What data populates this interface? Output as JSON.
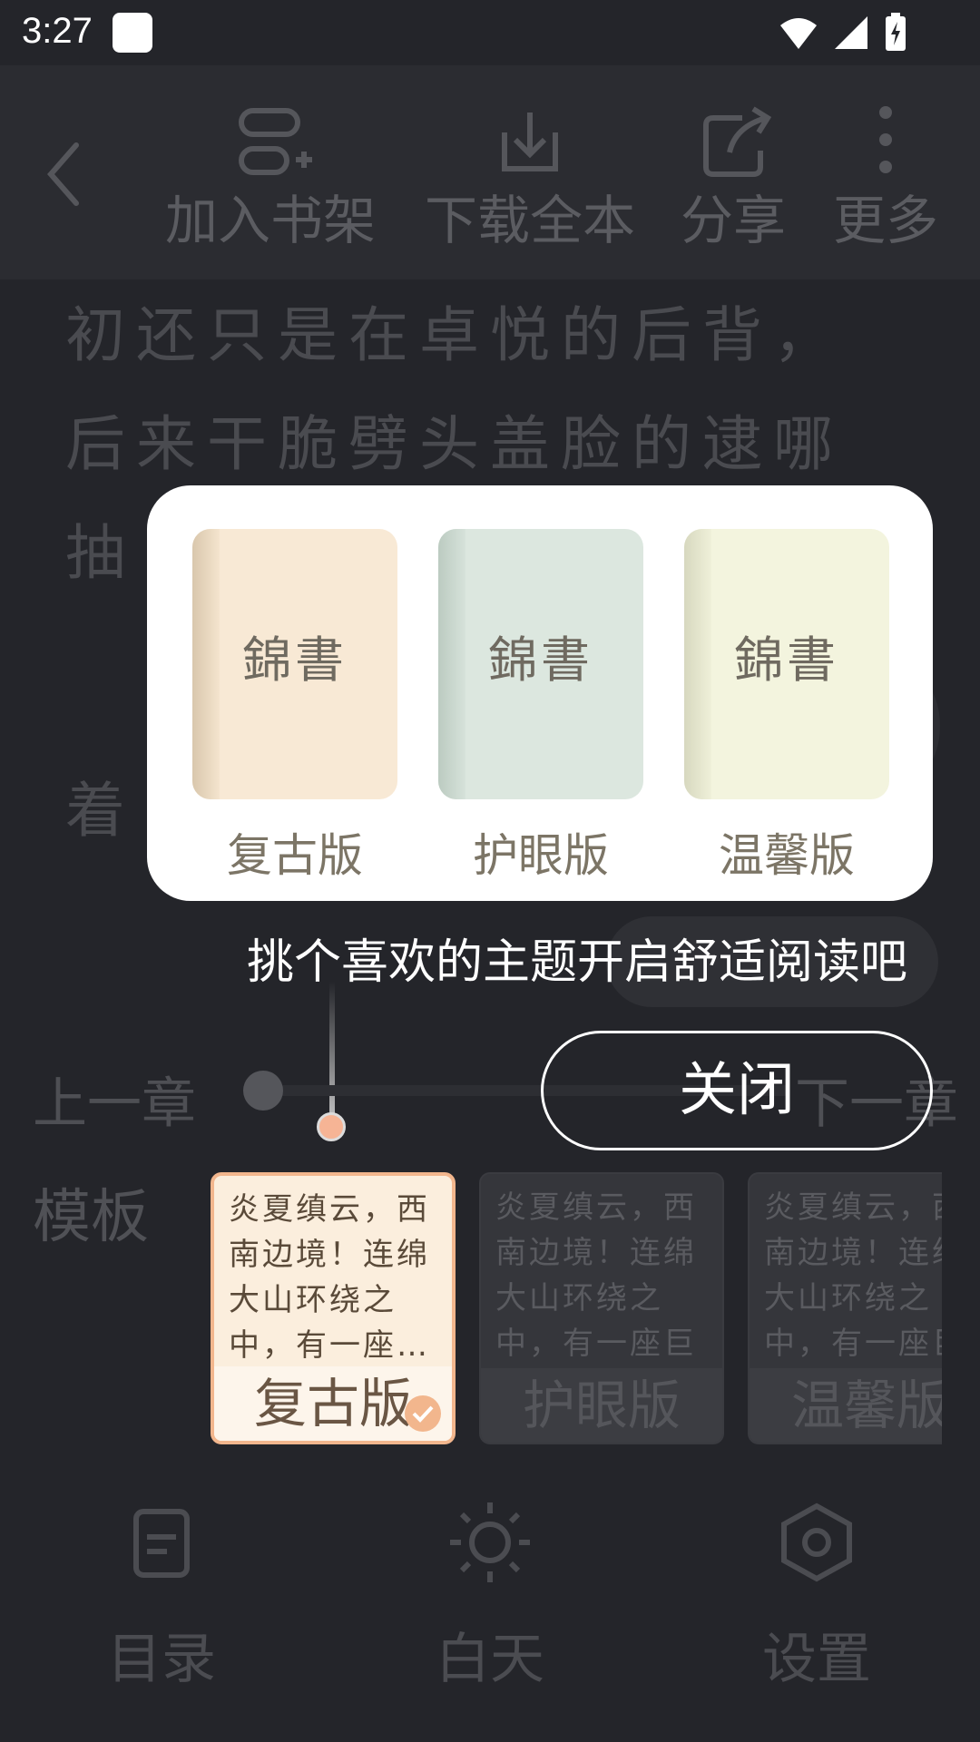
{
  "status_bar": {
    "time": "3:27"
  },
  "toolbar": {
    "add_shelf": "加入书架",
    "download_all": "下载全本",
    "share": "分享",
    "more": "更多"
  },
  "reading": {
    "lines": [
      "初还只是在卓悦的后背，",
      "后来干脆劈头盖脸的逮哪",
      "抽"
    ],
    "extra": "着"
  },
  "theme_popup": {
    "themes": [
      {
        "book_title": "錦書",
        "label": "复古版",
        "cover": "#f8e9d5",
        "spine": "#e2d3bd"
      },
      {
        "book_title": "錦書",
        "label": "护眼版",
        "cover": "#dce7df",
        "spine": "#c8d4cc"
      },
      {
        "book_title": "錦書",
        "label": "温馨版",
        "cover": "#f3f4de",
        "spine": "#e1e2ca"
      }
    ]
  },
  "tip": {
    "text": "挑个喜欢的主题开启舒适阅读吧",
    "close_label": "关闭"
  },
  "chapter_nav": {
    "prev": "上一章",
    "next": "下一章"
  },
  "templates": {
    "label": "模板",
    "items": [
      {
        "text": "炎夏缜云，西南边境！连绵大山环绕之中，有一座…",
        "name": "复古版",
        "selected": true
      },
      {
        "text": "炎夏缜云，西南边境！连绵大山环绕之中，有一座巨大一…",
        "name": "护眼版",
        "selected": false
      },
      {
        "text": "炎夏缜云，西南边境！连绵大山环绕之中，有一座巨大一…",
        "name": "温馨版",
        "selected": false
      }
    ]
  },
  "bottom_bar": {
    "toc": "目录",
    "day": "白天",
    "settings": "设置"
  },
  "icons": {
    "back": "chevron-left-icon",
    "add_shelf": "add-list-icon",
    "download": "download-icon",
    "share": "share-icon",
    "more": "more-vertical-icon",
    "toc": "document-icon",
    "day": "sun-icon",
    "settings": "hexagon-gear-icon"
  }
}
